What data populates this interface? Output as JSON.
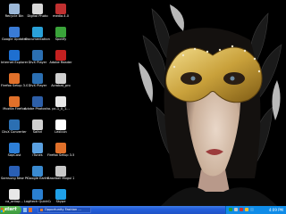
{
  "desktop": {
    "icons": [
      {
        "label": "Recycle Bin",
        "color": "#9cb8d8"
      },
      {
        "label": "Digital Photo",
        "color": "#d8d8d8"
      },
      {
        "label": "media.4.0",
        "color": "#c03030"
      },
      {
        "label": "Google Updater",
        "color": "#3a7bd5"
      },
      {
        "label": "Documentation",
        "color": "#2aa1d8"
      },
      {
        "label": "Spotify",
        "color": "#3aa33a"
      },
      {
        "label": "Internet Explorer",
        "color": "#1e6fd0"
      },
      {
        "label": "DivX Player",
        "color": "#2b6fb2"
      },
      {
        "label": "Adobe Reader",
        "color": "#c42020"
      },
      {
        "label": "Firefox Setup 3.0",
        "color": "#e0702a"
      },
      {
        "label": "DivX Player",
        "color": "#2b6fb2"
      },
      {
        "label": "Acrobat_pro",
        "color": "#cfcfcf"
      },
      {
        "label": "Mozilla Firefox",
        "color": "#e0702a"
      },
      {
        "label": "Adobe Photosho...",
        "color": "#2d5fa8"
      },
      {
        "label": "pc-1_0_1...",
        "color": "#e8e8e8"
      },
      {
        "label": "DivX Converter",
        "color": "#2b6fb2"
      },
      {
        "label": "Safari",
        "color": "#d0d0d0"
      },
      {
        "label": "Lexicon",
        "color": "#ffffff"
      },
      {
        "label": "SopCast",
        "color": "#2d7fd8"
      },
      {
        "label": "iTunes",
        "color": "#5aa0e0"
      },
      {
        "label": "Firefox Setup 3.5",
        "color": "#e0702a"
      },
      {
        "label": "Samsung New PC Studio",
        "color": "#2a5fb5"
      },
      {
        "label": "Google Earth",
        "color": "#3a8ad0"
      },
      {
        "label": "Baseball Mogul 2009 DEMO",
        "color": "#c8c8c8"
      },
      {
        "label": "ca_ontop...",
        "color": "#e8e8e8"
      },
      {
        "label": "Logitech QuickCam",
        "color": "#2a7fd0"
      },
      {
        "label": "Skype",
        "color": "#1fa0e8"
      }
    ]
  },
  "taskbar": {
    "start_label": "start",
    "task_label": "Opportunity Fashion ...",
    "clock": "4:09 PM",
    "colors": {
      "bar": "#245edb",
      "start": "#3a9a3a",
      "tray": "#0f8ce8"
    }
  }
}
